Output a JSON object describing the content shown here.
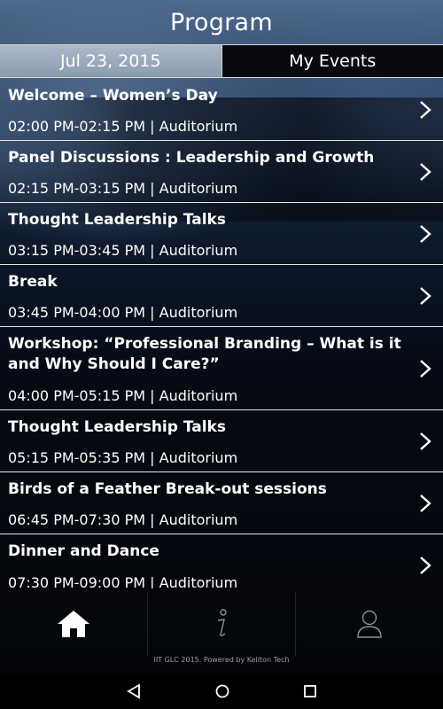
{
  "header": {
    "title": "Program"
  },
  "tabs": [
    {
      "label": "Jul 23, 2015",
      "active": true
    },
    {
      "label": "My Events",
      "active": false
    }
  ],
  "events": [
    {
      "title": "Welcome – Women’s Day",
      "time": "02:00 PM-02:15 PM",
      "location": "Auditorium"
    },
    {
      "title": "Panel Discussions : Leadership and Growth",
      "time": "02:15 PM-03:15 PM",
      "location": "Auditorium"
    },
    {
      "title": "Thought Leadership Talks",
      "time": "03:15 PM-03:45 PM",
      "location": "Auditorium"
    },
    {
      "title": "Break",
      "time": "03:45 PM-04:00 PM",
      "location": "Auditorium"
    },
    {
      "title": "Workshop: “Professional Branding – What is it and Why Should I Care?”",
      "time": "04:00 PM-05:15 PM",
      "location": "Auditorium"
    },
    {
      "title": "Thought Leadership Talks",
      "time": "05:15 PM-05:35 PM",
      "location": "Auditorium"
    },
    {
      "title": "Birds of a Feather Break-out sessions",
      "time": "06:45 PM-07:30 PM",
      "location": "Auditorium"
    },
    {
      "title": "Dinner and Dance",
      "time": "07:30 PM-09:00 PM",
      "location": "Auditorium"
    }
  ],
  "meta_separator": "|",
  "bottom_nav": [
    {
      "icon": "home-icon"
    },
    {
      "icon": "info-icon"
    },
    {
      "icon": "profile-icon"
    }
  ],
  "footer": {
    "text": "IIT GLC 2015. Powered by Kellton Tech"
  },
  "system_nav": [
    {
      "icon": "back-icon"
    },
    {
      "icon": "home-circle-icon"
    },
    {
      "icon": "recents-icon"
    }
  ],
  "colors": {
    "text": "#ffffff",
    "divider": "#e6e6e6",
    "active_tab": "#aeb9c6",
    "background": "#05070d"
  }
}
